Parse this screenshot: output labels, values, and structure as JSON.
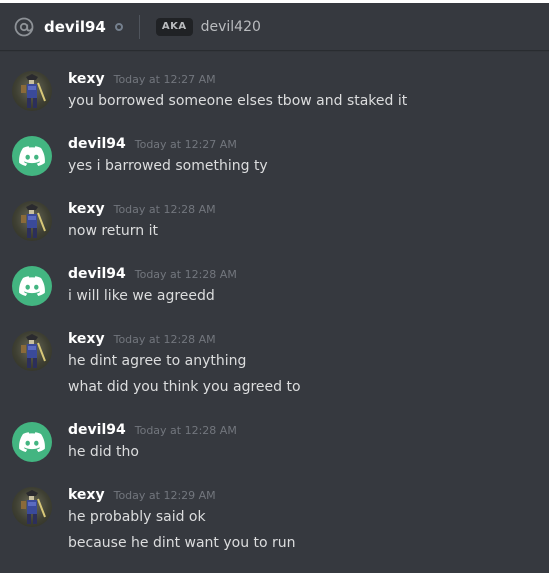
{
  "header": {
    "username": "devil94",
    "aka_badge": "AKA",
    "aka_name": "devil420"
  },
  "colors": {
    "background": "#36393f",
    "discord_green": "#43b581",
    "username": "#ffffff",
    "timestamp": "#72767d",
    "text": "#dcddde"
  },
  "messages": [
    {
      "author": "kexy",
      "avatar": "kexy-avatar",
      "time": "Today at 12:27 AM",
      "lines": [
        "you borrowed someone elses tbow and staked it"
      ]
    },
    {
      "author": "devil94",
      "avatar": "discord-default-avatar",
      "time": "Today at 12:27 AM",
      "lines": [
        "yes i  barrowed something ty"
      ]
    },
    {
      "author": "kexy",
      "avatar": "kexy-avatar",
      "time": "Today at 12:28 AM",
      "lines": [
        "now return it"
      ]
    },
    {
      "author": "devil94",
      "avatar": "discord-default-avatar",
      "time": "Today at 12:28 AM",
      "lines": [
        "i will like we agreedd"
      ]
    },
    {
      "author": "kexy",
      "avatar": "kexy-avatar",
      "time": "Today at 12:28 AM",
      "lines": [
        "he dint agree to anything",
        "what did you think you agreed to"
      ]
    },
    {
      "author": "devil94",
      "avatar": "discord-default-avatar",
      "time": "Today at 12:28 AM",
      "lines": [
        "he did tho"
      ]
    },
    {
      "author": "kexy",
      "avatar": "kexy-avatar",
      "time": "Today at 12:29 AM",
      "lines": [
        "he probably said ok",
        "because he dint want you to run"
      ]
    }
  ]
}
